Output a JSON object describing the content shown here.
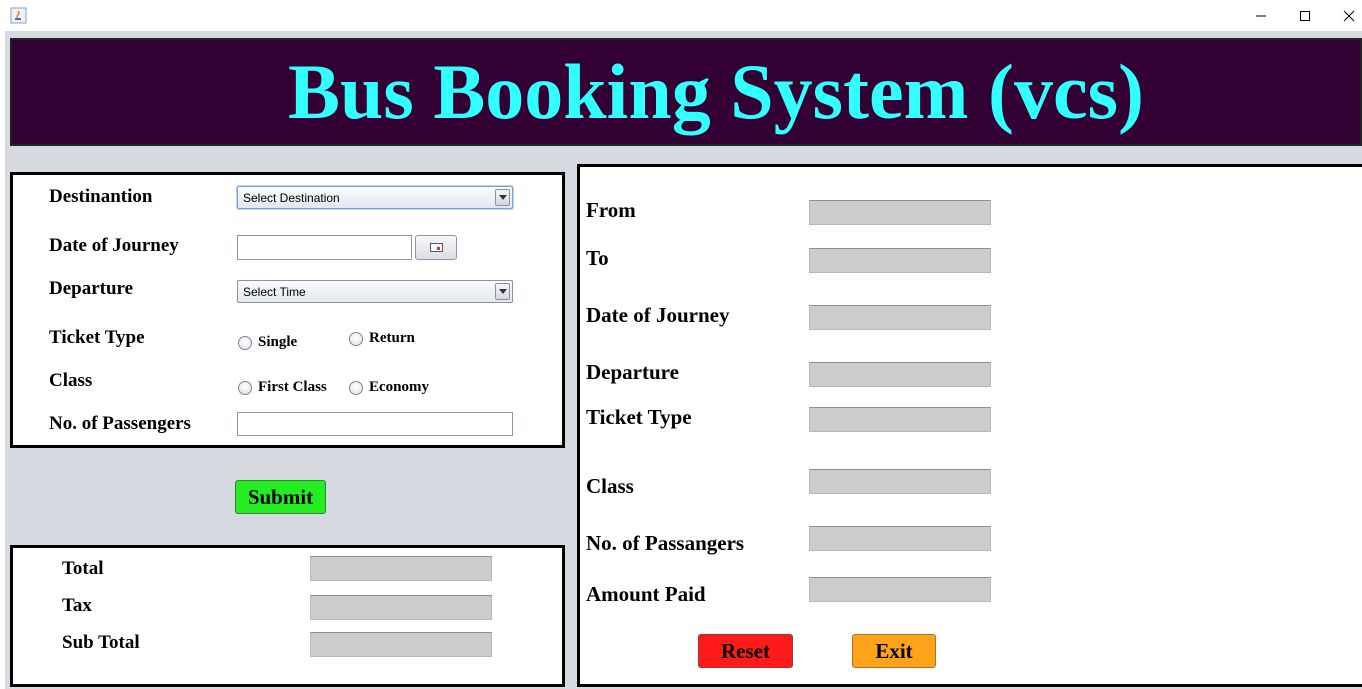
{
  "window": {
    "app_icon": "java-cup-icon",
    "controls": [
      "minimize-icon",
      "maximize-icon",
      "close-icon"
    ]
  },
  "header": {
    "title": "Bus Booking System (vcs)"
  },
  "booking_form": {
    "destination": {
      "label": "Destinantion",
      "selected": "Select Destination"
    },
    "date_of_journey": {
      "label": "Date of Journey",
      "value": ""
    },
    "departure": {
      "label": "Departure",
      "selected": "Select Time"
    },
    "ticket_type": {
      "label": "Ticket Type",
      "options": [
        "Single",
        "Return"
      ]
    },
    "class": {
      "label": "Class",
      "options": [
        "First Class",
        "Economy"
      ]
    },
    "passengers": {
      "label": "No. of Passengers",
      "value": ""
    }
  },
  "submit_label": "Submit",
  "totals": {
    "total_label": "Total",
    "tax_label": "Tax",
    "subtotal_label": "Sub Total"
  },
  "summary": {
    "from_label": "From",
    "to_label": "To",
    "date_label": "Date of Journey",
    "departure_label": "Departure",
    "ticket_type_label": "Ticket Type",
    "class_label": "Class",
    "passengers_label": "No. of Passangers",
    "amount_label": "Amount Paid"
  },
  "actions": {
    "reset_label": "Reset",
    "exit_label": "Exit"
  },
  "colors": {
    "header_bg": "#330033",
    "header_text": "#33ffff",
    "submit": "#22ee22",
    "reset": "#ff1a1a",
    "exit": "#ffa31a"
  }
}
